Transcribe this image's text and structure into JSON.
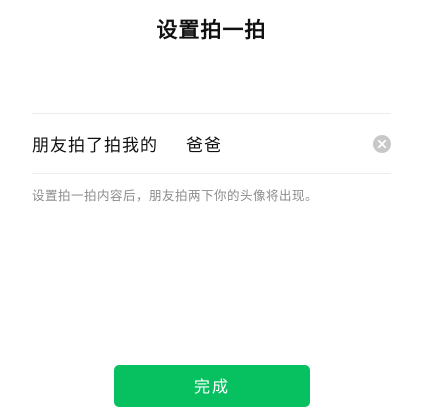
{
  "header": {
    "title": "设置拍一拍"
  },
  "pat": {
    "prefix": "朋友拍了拍我的",
    "value": "爸爸",
    "clear_icon": "clear-icon"
  },
  "hint": "设置拍一拍内容后，朋友拍两下你的头像将出现。",
  "footer": {
    "done_label": "完成"
  },
  "colors": {
    "accent": "#07c160",
    "hint_text": "#8c8c8c",
    "clear_icon_bg": "#c8c8c8"
  }
}
